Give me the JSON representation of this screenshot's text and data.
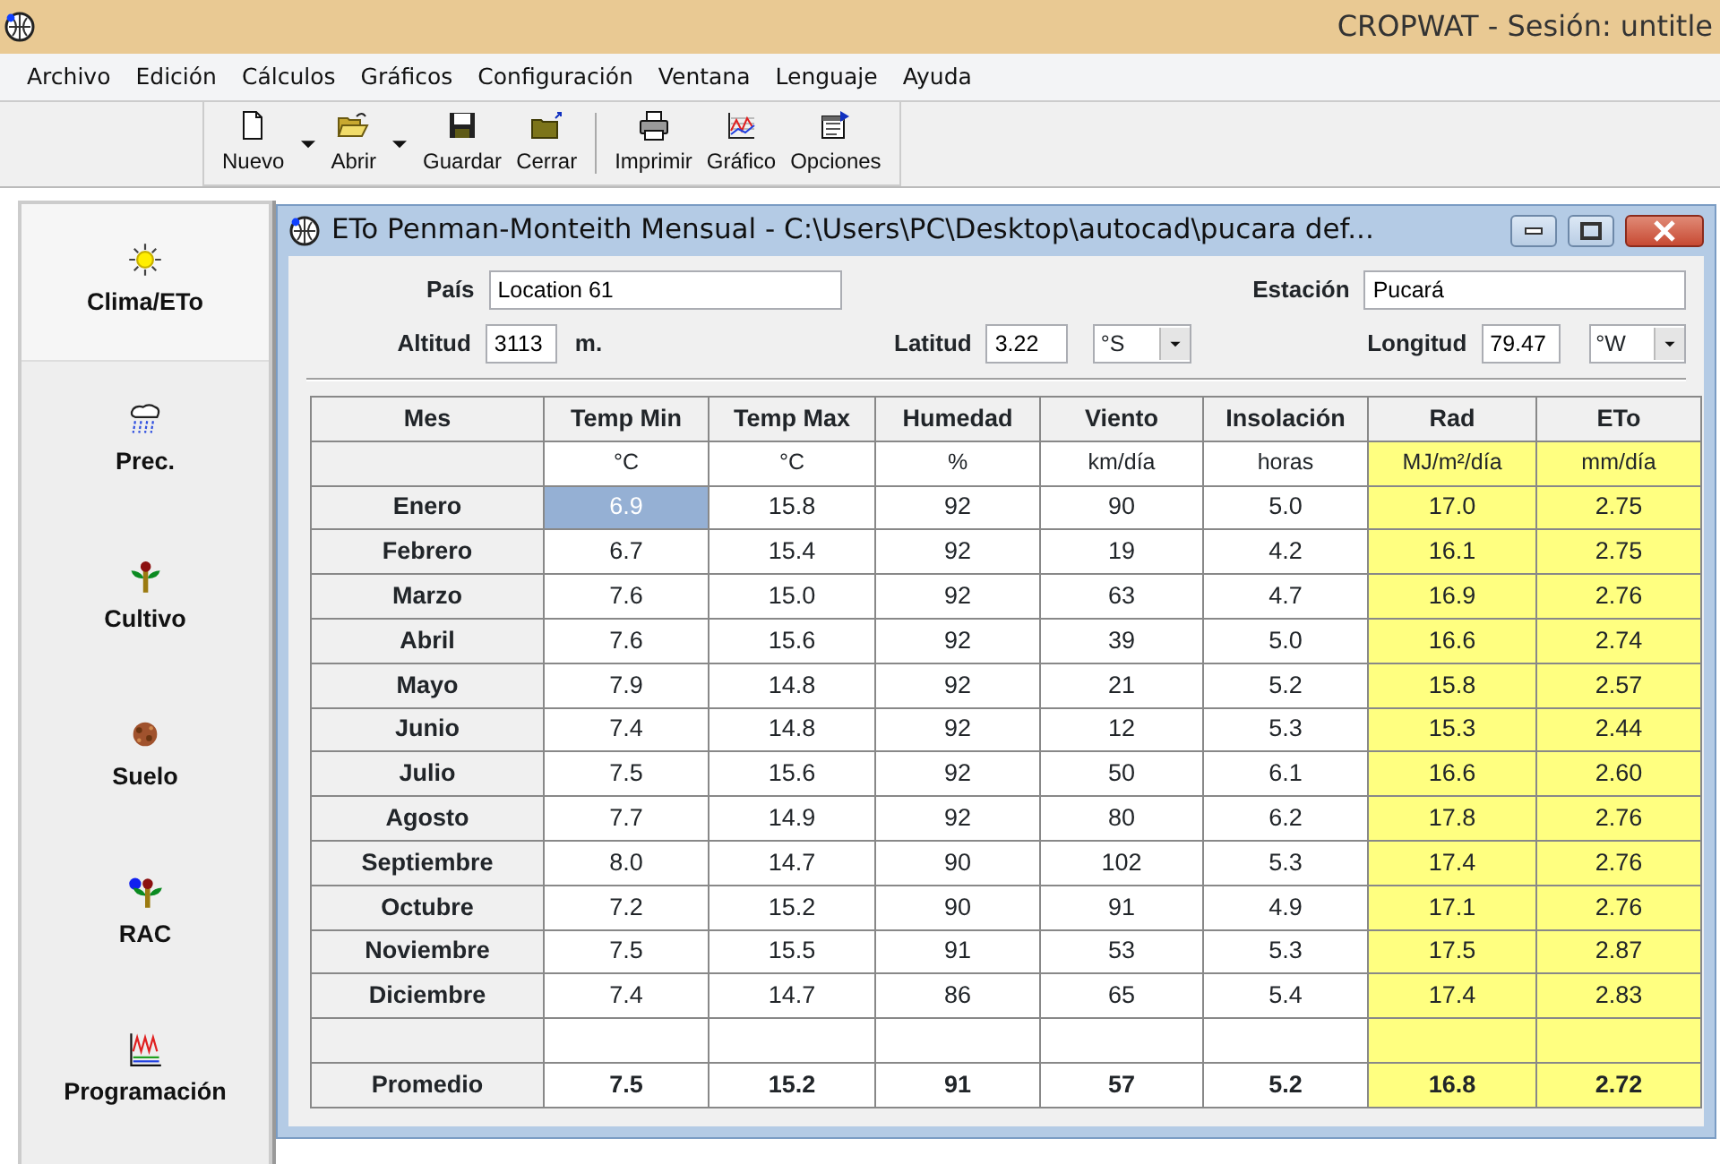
{
  "app": {
    "title": "CROPWAT - Sesión: untitle"
  },
  "menu": [
    "Archivo",
    "Edición",
    "Cálculos",
    "Gráficos",
    "Configuración",
    "Ventana",
    "Lenguaje",
    "Ayuda"
  ],
  "toolbar": [
    {
      "label": "Nuevo",
      "kind": "new",
      "dropdown": true,
      "separator_before": false
    },
    {
      "label": "Abrir",
      "kind": "open",
      "dropdown": true,
      "separator_before": false
    },
    {
      "label": "Guardar",
      "kind": "save",
      "dropdown": false,
      "separator_before": false
    },
    {
      "label": "Cerrar",
      "kind": "close",
      "dropdown": false,
      "separator_before": false
    },
    {
      "label": "Imprimir",
      "kind": "print",
      "dropdown": false,
      "separator_before": true
    },
    {
      "label": "Gráfico",
      "kind": "chart",
      "dropdown": false,
      "separator_before": false
    },
    {
      "label": "Opciones",
      "kind": "options",
      "dropdown": false,
      "separator_before": false
    }
  ],
  "sidebar": [
    {
      "label": "Clima/ETo",
      "kind": "sun",
      "selected": true
    },
    {
      "label": "Prec.",
      "kind": "rain",
      "selected": false
    },
    {
      "label": "Cultivo",
      "kind": "crop",
      "selected": false
    },
    {
      "label": "Suelo",
      "kind": "soil",
      "selected": false
    },
    {
      "label": "RAC",
      "kind": "crop_water",
      "selected": false
    },
    {
      "label": "Programación",
      "kind": "schedule",
      "selected": false
    }
  ],
  "child_window": {
    "title": "ETo Penman-Monteith Mensual - C:\\Users\\PC\\Desktop\\autocad\\pucara def...",
    "pais": {
      "label": "País",
      "value": "Location 61"
    },
    "estacion": {
      "label": "Estación",
      "value": "Pucará"
    },
    "altitud": {
      "label": "Altitud",
      "value": "3113",
      "unit": "m."
    },
    "latitud": {
      "label": "Latitud",
      "value": "3.22",
      "hemisphere": "°S"
    },
    "longitud": {
      "label": "Longitud",
      "value": "79.47",
      "hemisphere": "°W"
    },
    "table": {
      "columns": [
        {
          "header": "Mes",
          "computed": false
        },
        {
          "header": "Temp Min",
          "unit": "°C",
          "computed": false
        },
        {
          "header": "Temp Max",
          "unit": "°C",
          "computed": false
        },
        {
          "header": "Humedad",
          "unit": "%",
          "computed": false
        },
        {
          "header": "Viento",
          "unit": "km/día",
          "computed": false
        },
        {
          "header": "Insolación",
          "unit": "horas",
          "computed": false
        },
        {
          "header": "Rad",
          "unit": "MJ/m²/día",
          "computed": true
        },
        {
          "header": "ETo",
          "unit": "mm/día",
          "computed": true
        }
      ],
      "rows": [
        {
          "month": "Enero",
          "values": [
            "6.9",
            "15.8",
            "92",
            "90",
            "5.0",
            "17.0",
            "2.75"
          ],
          "selected": [
            true,
            false,
            false,
            false,
            false,
            false,
            false
          ]
        },
        {
          "month": "Febrero",
          "values": [
            "6.7",
            "15.4",
            "92",
            "19",
            "4.2",
            "16.1",
            "2.75"
          ],
          "selected": [
            false,
            false,
            false,
            false,
            false,
            false,
            false
          ]
        },
        {
          "month": "Marzo",
          "values": [
            "7.6",
            "15.0",
            "92",
            "63",
            "4.7",
            "16.9",
            "2.76"
          ],
          "selected": [
            false,
            false,
            false,
            false,
            false,
            false,
            false
          ]
        },
        {
          "month": "Abril",
          "values": [
            "7.6",
            "15.6",
            "92",
            "39",
            "5.0",
            "16.6",
            "2.74"
          ],
          "selected": [
            false,
            false,
            false,
            false,
            false,
            false,
            false
          ]
        },
        {
          "month": "Mayo",
          "values": [
            "7.9",
            "14.8",
            "92",
            "21",
            "5.2",
            "15.8",
            "2.57"
          ],
          "selected": [
            false,
            false,
            false,
            false,
            false,
            false,
            false
          ]
        },
        {
          "month": "Junio",
          "values": [
            "7.4",
            "14.8",
            "92",
            "12",
            "5.3",
            "15.3",
            "2.44"
          ],
          "selected": [
            false,
            false,
            false,
            false,
            false,
            false,
            false
          ]
        },
        {
          "month": "Julio",
          "values": [
            "7.5",
            "15.6",
            "92",
            "50",
            "6.1",
            "16.6",
            "2.60"
          ],
          "selected": [
            false,
            false,
            false,
            false,
            false,
            false,
            false
          ]
        },
        {
          "month": "Agosto",
          "values": [
            "7.7",
            "14.9",
            "92",
            "80",
            "6.2",
            "17.8",
            "2.76"
          ],
          "selected": [
            false,
            false,
            false,
            false,
            false,
            false,
            false
          ]
        },
        {
          "month": "Septiembre",
          "values": [
            "8.0",
            "14.7",
            "90",
            "102",
            "5.3",
            "17.4",
            "2.76"
          ],
          "selected": [
            false,
            false,
            false,
            false,
            false,
            false,
            false
          ]
        },
        {
          "month": "Octubre",
          "values": [
            "7.2",
            "15.2",
            "90",
            "91",
            "4.9",
            "17.1",
            "2.76"
          ],
          "selected": [
            false,
            false,
            false,
            false,
            false,
            false,
            false
          ]
        },
        {
          "month": "Noviembre",
          "values": [
            "7.5",
            "15.5",
            "91",
            "53",
            "5.3",
            "17.5",
            "2.87"
          ],
          "selected": [
            false,
            false,
            false,
            false,
            false,
            false,
            false
          ]
        },
        {
          "month": "Diciembre",
          "values": [
            "7.4",
            "14.7",
            "86",
            "65",
            "5.4",
            "17.4",
            "2.83"
          ],
          "selected": [
            false,
            false,
            false,
            false,
            false,
            false,
            false
          ]
        }
      ],
      "average": {
        "label": "Promedio",
        "values": [
          "7.5",
          "15.2",
          "91",
          "57",
          "5.2",
          "16.8",
          "2.72"
        ]
      }
    }
  }
}
